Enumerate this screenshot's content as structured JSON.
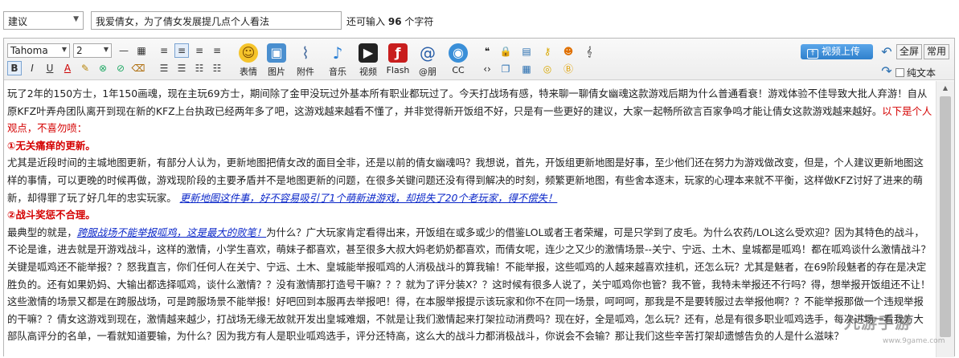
{
  "category_select": {
    "value": "建议"
  },
  "title_input": {
    "value": "我爱倩女，为了倩女发展提几点个人看法"
  },
  "remaining": {
    "prefix": "还可输入",
    "count": "96",
    "suffix": "个字符"
  },
  "toolbar": {
    "font_family": "Tahoma",
    "font_size": "2",
    "bold": "B",
    "italic": "I",
    "underline": "U",
    "fontcolor": "A",
    "buttons": {
      "emoji": "表情",
      "image": "图片",
      "attachment": "附件",
      "music": "音乐",
      "video": "视频",
      "flash": "Flash",
      "at": "@朋",
      "cc": "CC"
    },
    "upload_video": "视频上传",
    "fullscreen": "全屏",
    "common": "常用",
    "plain_text": "纯文本"
  },
  "content": {
    "p1_a": "玩了2年的150方士，1年150画魂，现在主玩69方士，期间除了金甲没玩过外基本所有职业都玩过了。今天打战场有感，特来聊一聊倩女幽魂这款游戏后期为什么普通看衰！游戏体验不佳导致大批人弃游！自从原KFZ叶弄舟团队离开到现在新的KFZ上台执政已经两年多了吧，这游戏越来越看不懂了，并非觉得新开饭组不好，只是有一些更好的建议，大家一起畅所欲言百家争鸣才能让倩女这款游戏越来越好。",
    "p1_red": "以下是个人观点，不喜勿喷：",
    "h1": "①无关痛痒的更新。",
    "p2": "尤其是近段时间的主城地图更新，有部分人认为，更新地图把倩女改的面目全非，还是以前的倩女幽魂吗？我想说，首先，开饭组更新地图是好事，至少他们还在努力为游戏做改变，但是，个人建议更新地图这样的事情，可以更晚的时候再做，游戏现阶段的主要矛盾并不是地图更新的问题，在很多关键问题还没有得到解决的时刻，频繁更新地图，有些舍本逐末，玩家的心理本来就不平衡，这样做KFZ讨好了进来的萌新，却得罪了玩了好几年的忠实玩家。",
    "p2_link": "更新地图这件事，好不容易吸引了1个萌新进游戏，却损失了20个老玩家，得不偿失！",
    "h2": "②战斗奖惩不合理。",
    "p3_a": "最典型的就是，",
    "p3_link": "跨服战场不能举报呱鸡，这是最大的败笔！",
    "p3_b": "为什么？广大玩家肯定看得出来，开饭组在或多或少的借鉴LOL或者王者荣耀，可是只学到了皮毛。为什么农药/LOL这么受欢迎？因为其特色的战斗，不论是谁，进去就是开游戏战斗，这样的激情，小学生喜欢，萌妹子都喜欢，甚至很多大叔大妈老奶奶都喜欢，而倩女呢，连少之又少的激情场景--关宁、宁远、土木、皇城都是呱鸡！都在呱鸡谈什么激情战斗？关键是呱鸡还不能举报？？怒我直言，你们任何人在关宁、宁远、土木、皇城能举报呱鸡的人消极战斗的算我输！不能举报，这些呱鸡的人越来越喜欢挂机，还怎么玩？尤其是魅者，在69阶段魅者的存在是决定胜负的。还有如果奶妈、大输出都选择呱鸡，谈什么激情？？没有激情那打造号干嘛？？？就为了评分装X？？这时候有很多人说了，关宁呱鸡你也管？我不管，我特未举报还不行吗？得，想举报开饭组还不让！这些激情的场景又都是在跨服战场，可是跨服场景不能举报！好吧回到本服再去举报吧！得，在本服举报提示该玩家和你不在同一场景，呵呵呵，那我是不是要转服过去举报他啊？？不能举报那做一个违规举报的干嘛？？倩女这游戏到现在，激情越来越少，打战场无缘无故就开发出皇城难烟，不就是让我们激情起来打架拉动消费吗？现在好，全是呱鸡，怎么玩？还有，总是有很多职业呱鸡选手，每次进场一看我方大部队高评分的名单，一看就知道要输，为什么？因为我方有人是职业呱鸡选手，评分还特高，这么大的战斗力都消极战斗，你说会不会输？那让我们这些辛苦打架却遗憾告负的人是什么滋味？"
  },
  "watermark": {
    "text": "九游手游",
    "url": "www.9game.com"
  },
  "colors": {
    "accent_red": "#d40000",
    "link_blue": "#0a26c8",
    "upload_blue": "#2f80cc"
  }
}
